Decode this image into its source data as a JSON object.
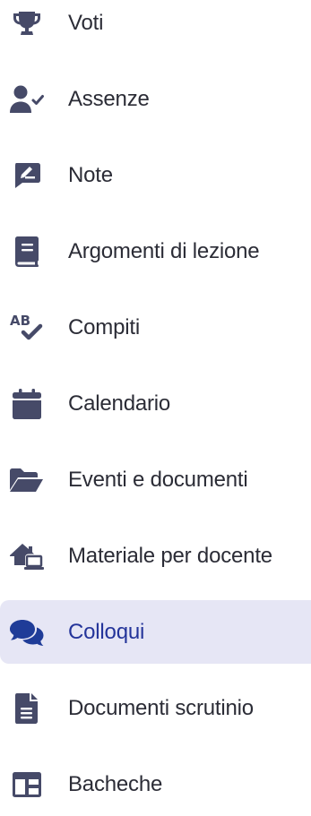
{
  "menu": {
    "items": [
      {
        "label": "Voti",
        "icon": "trophy-icon"
      },
      {
        "label": "Assenze",
        "icon": "user-check-icon"
      },
      {
        "label": "Note",
        "icon": "note-pen-icon"
      },
      {
        "label": "Argomenti di lezione",
        "icon": "book-icon"
      },
      {
        "label": "Compiti",
        "icon": "spellcheck-icon"
      },
      {
        "label": "Calendario",
        "icon": "calendar-icon"
      },
      {
        "label": "Eventi e documenti",
        "icon": "folder-open-icon"
      },
      {
        "label": "Materiale per docente",
        "icon": "house-laptop-icon"
      },
      {
        "label": "Colloqui",
        "icon": "comments-icon",
        "active": true
      },
      {
        "label": "Documenti scrutinio",
        "icon": "file-lines-icon"
      },
      {
        "label": "Bacheche",
        "icon": "board-icon"
      }
    ]
  },
  "colors": {
    "icon": "#464a68",
    "text": "#2b2c36",
    "active_background": "#e6e6f5",
    "active_icon": "#1f3c98",
    "active_text": "#24349a"
  }
}
